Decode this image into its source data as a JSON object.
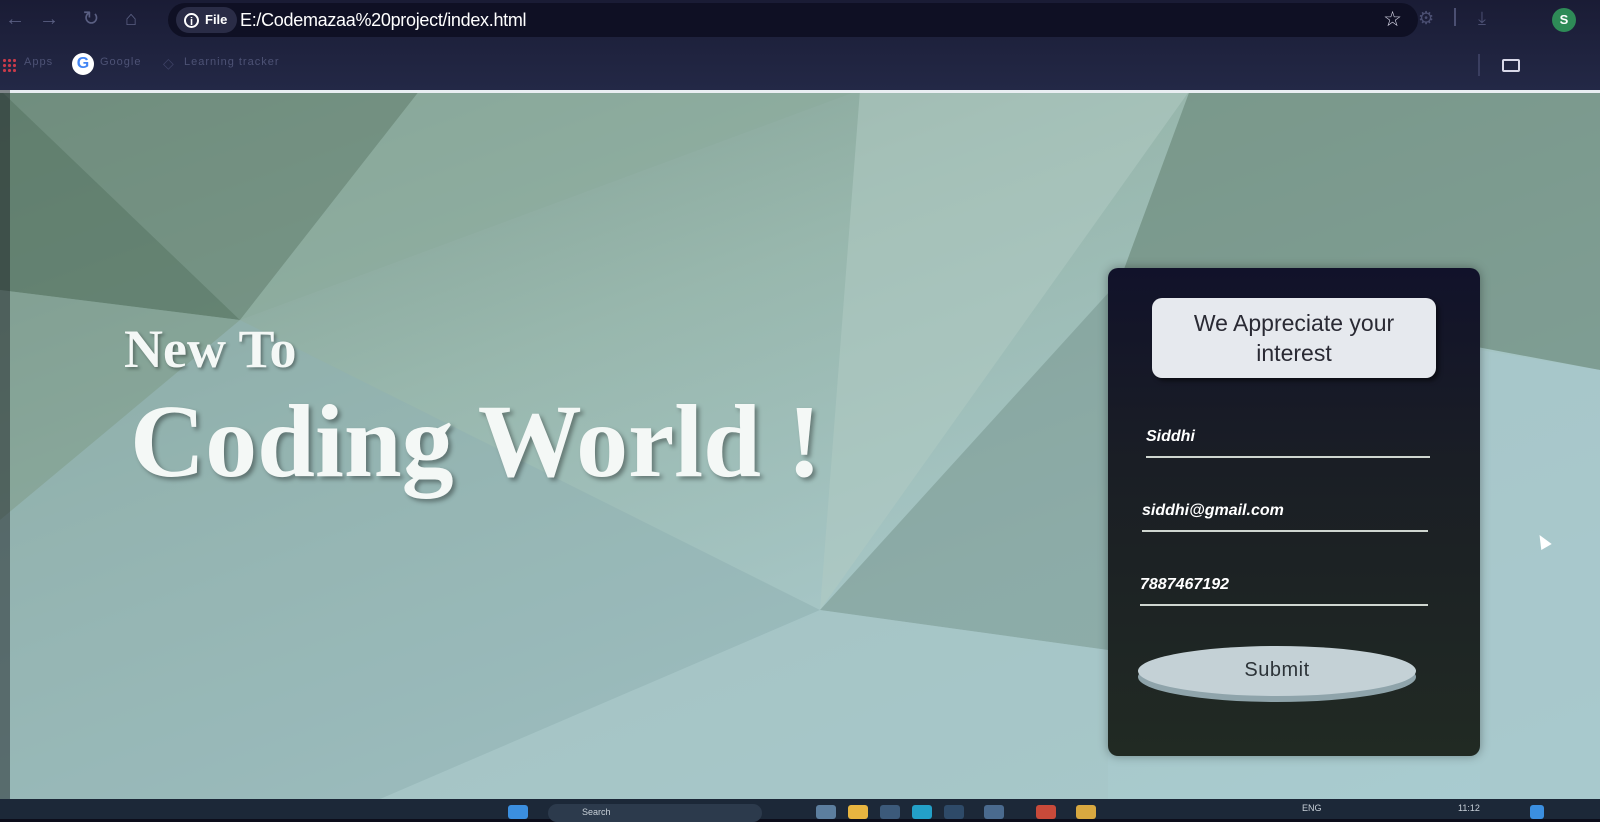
{
  "browser": {
    "info_chip_label": "File",
    "url": "E:/Codemazaa%20project/index.html",
    "avatar_letter": "S",
    "bookmarks": [
      {
        "label": "Apps"
      },
      {
        "label": "Google"
      },
      {
        "label": "Learning tracker"
      }
    ]
  },
  "page": {
    "headline_small": "New To",
    "headline_big": "Coding World !"
  },
  "form": {
    "heading": "We Appreciate your interest",
    "name_value": "Siddhi",
    "email_value": "siddhi@gmail.com",
    "phone_value": "7887467192",
    "submit_label": "Submit"
  },
  "taskbar": {
    "search_label": "Search",
    "language": "ENG",
    "time": "11:12"
  },
  "colors": {
    "card_bg": "#11122a",
    "heading_bg": "#e6e9ee",
    "submit_bg": "#c4d1d6",
    "headline_text": "#f4f8f6"
  }
}
